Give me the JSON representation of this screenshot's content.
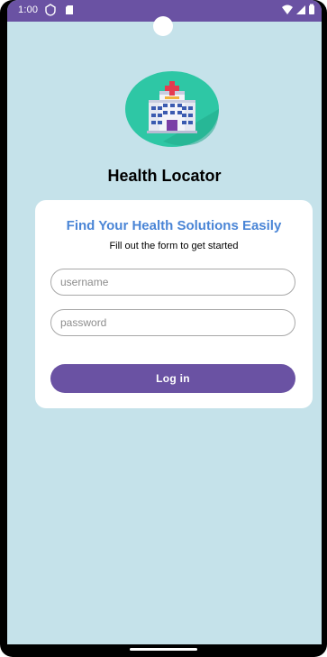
{
  "status_bar": {
    "time": "1:00",
    "icons": [
      "data-saver-icon",
      "sd-card-icon",
      "wifi-icon",
      "cellular-icon",
      "battery-icon"
    ]
  },
  "app": {
    "title": "Health Locator",
    "logo_icon": "hospital-icon"
  },
  "card": {
    "title": "Find Your Health Solutions Easily",
    "subtitle": "Fill out the form to get started",
    "username_placeholder": "username",
    "password_placeholder": "password",
    "login_label": "Log in"
  },
  "colors": {
    "primary": "#6a52a3",
    "background": "#c5e2ea",
    "title_blue": "#4a85d6",
    "logo_circle": "#2ec7a5"
  }
}
